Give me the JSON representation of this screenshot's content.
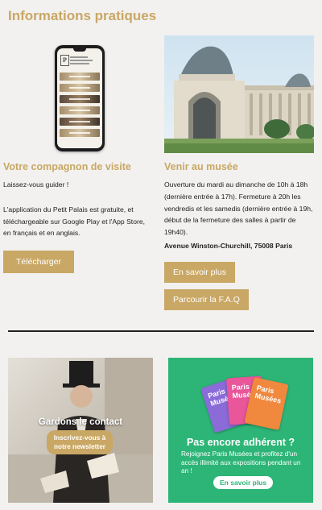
{
  "page": {
    "title": "Informations pratiques"
  },
  "colors": {
    "gold": "#c9a764",
    "green": "#2db577",
    "background": "#f2f1ef"
  },
  "visit_companion": {
    "title": "Votre compagnon de visite",
    "intro": "Laissez-vous guider !",
    "body": "L'application du Petit Palais est gratuite, et téléchargeable sur Google Play et l'App Store, en français et en anglais.",
    "download_label": "Télécharger"
  },
  "getting_there": {
    "title": "Venir au musée",
    "hours": "Ouverture du mardi au dimanche de 10h à 18h (dernière entrée à 17h). Fermeture à 20h les vendredis et les samedis (dernière entrée à 19h, début de la fermeture des salles à partir de 19h40).",
    "address": "Avenue Winston-Churchill, 75008 Paris",
    "more_label": "En savoir plus",
    "faq_label": "Parcourir la F.A.Q"
  },
  "newsletter": {
    "title": "Gardons le contact",
    "button_label": "Inscrivez-vous à notre newsletter"
  },
  "membership": {
    "ticket_text": "Paris Musées",
    "title": "Pas encore adhérent ?",
    "text": "Rejoignez Paris Musées et profitez d'un accès illimité aux expositions pendant un an !",
    "button_label": "En savoir plus"
  }
}
